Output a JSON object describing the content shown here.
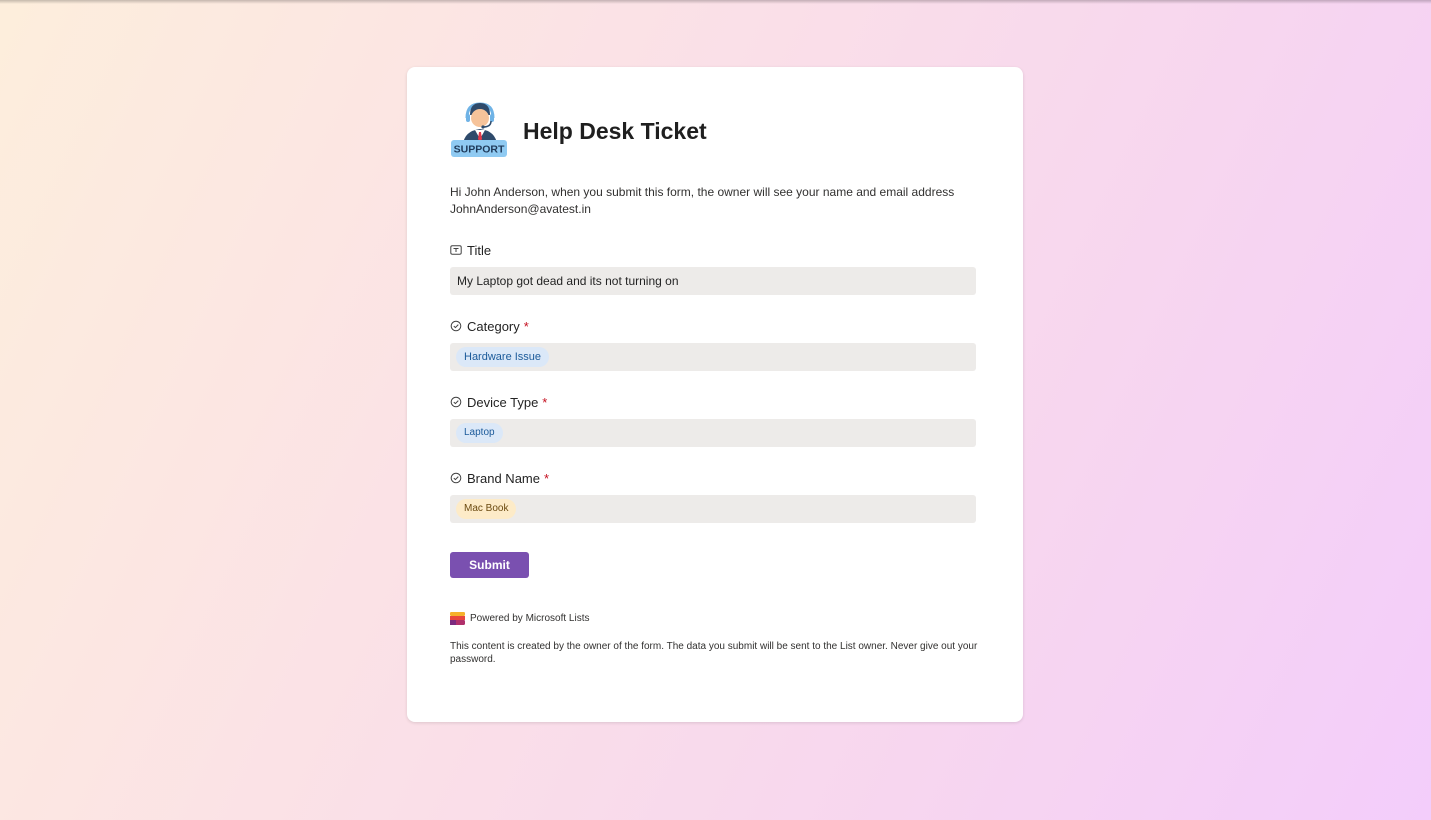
{
  "form": {
    "title": "Help Desk Ticket",
    "logo_text": "SUPPORT",
    "intro_line1": "Hi John Anderson, when you submit this form, the owner will see your name and email address",
    "intro_line2": "JohnAnderson@avatest.in",
    "required_marker": "*",
    "fields": [
      {
        "label": "Title",
        "icon": "text-field-icon",
        "value": "My Laptop got dead and its not turning on",
        "required": false
      },
      {
        "label": "Category",
        "icon": "choice-check-icon",
        "value": "Hardware Issue",
        "required": true,
        "chip_color": "#dbe8f8"
      },
      {
        "label": "Device Type",
        "icon": "choice-check-icon",
        "value": "Laptop",
        "required": true,
        "chip_color": "#dbe8f8"
      },
      {
        "label": "Brand Name",
        "icon": "choice-check-icon",
        "value": "Mac Book",
        "required": true,
        "chip_color": "#fdebc8"
      }
    ],
    "submit_label": "Submit",
    "powered_by": "Powered by Microsoft Lists",
    "disclaimer": "This content is created by the owner of the form. The data you submit will be sent to the List owner. Never give out your password."
  },
  "colors": {
    "accent": "#7a50b0",
    "required": "#c50f1f",
    "field_bg": "#edebe9"
  }
}
